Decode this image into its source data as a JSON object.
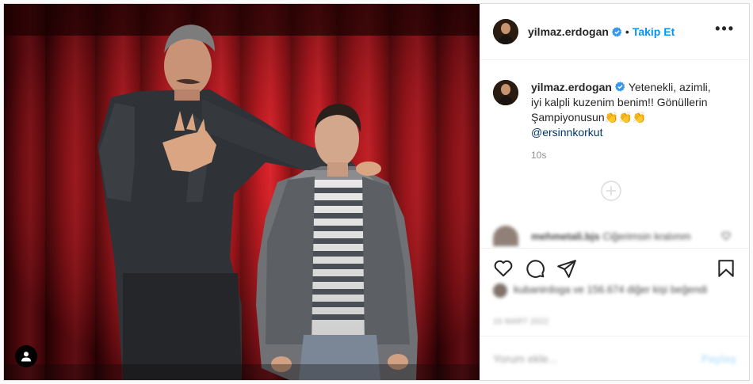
{
  "post": {
    "username": "yilmaz.erdogan",
    "follow_label": "Takip Et",
    "separator": "•",
    "more_label": "•••"
  },
  "caption": {
    "username": "yilmaz.erdogan",
    "text": "Yetenekli, azimli, iyi kalpli kuzenim benim!! Gönüllerin Şampiyonusun👏👏👏",
    "mention": "@ersinnkorkut",
    "time": "10s"
  },
  "comment": {
    "username": "mehmetali.bjs",
    "text": "Ciğerimsin kralımm"
  },
  "likes": {
    "text": "kubanirdoga ve 156.674 diğer kişi beğendi"
  },
  "date": "16 MART 2022",
  "add_comment": {
    "placeholder": "Yorum ekle...",
    "post_label": "Paylaş"
  },
  "icons": {
    "verified": "verified-badge-icon",
    "like": "heart-icon",
    "comment": "comment-icon",
    "share": "paper-plane-icon",
    "save": "bookmark-icon",
    "tags": "user-tag-icon",
    "load_more": "plus-circle-icon"
  },
  "colors": {
    "accent": "#0095f6",
    "verified": "#3897f0",
    "curtain": "#8c0a12"
  }
}
